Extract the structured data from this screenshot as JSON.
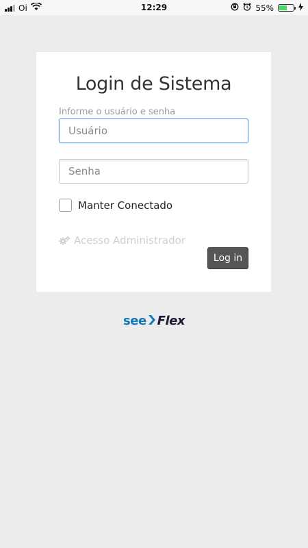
{
  "status_bar": {
    "carrier": "Oi",
    "time": "12:29",
    "battery_percent": "55%",
    "battery_level": 0.55,
    "icons": [
      "signal-icon",
      "wifi-icon",
      "rotation-lock-icon",
      "alarm-icon",
      "battery-icon",
      "charging-icon"
    ]
  },
  "login": {
    "title": "Login de Sistema",
    "helper_text": "Informe o usuário e senha",
    "username_placeholder": "Usuário",
    "password_placeholder": "Senha",
    "remember_label": "Manter Conectado",
    "remember_checked": false,
    "admin_link": "Acesso Administrador",
    "admin_icon": "gears-icon",
    "submit_label": "Log in"
  },
  "brand": {
    "part1": "see",
    "part2": "Flex",
    "colors": {
      "see": "#1478b6",
      "flex": "#1b1b3a"
    }
  },
  "colors": {
    "background": "#ececec",
    "card": "#ffffff",
    "focus_border": "#5b9be6",
    "button": "#555555"
  }
}
